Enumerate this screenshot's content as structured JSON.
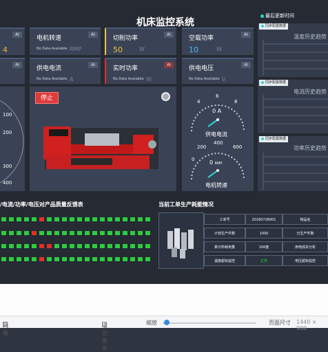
{
  "header": {
    "title": "机床监控系统",
    "update_text": "最后更新时间"
  },
  "cards": [
    {
      "label": "",
      "value": "4",
      "unit": "",
      "value_color": "#f0b030",
      "ai": "AI"
    },
    {
      "label": "电机转速",
      "value": "No Data Available",
      "unit": "RMP",
      "ai": "AI"
    },
    {
      "label": "切削功率",
      "value": "50",
      "unit": "W",
      "value_color": "#f0c040",
      "ai": "AI"
    },
    {
      "label": "空载功率",
      "value": "10",
      "unit": "W",
      "value_color": "#4db5ff",
      "ai": "AI"
    },
    {
      "label": "",
      "value": "",
      "unit": "",
      "ai": "AI"
    },
    {
      "label": "供电电流",
      "value": "No Data Available",
      "unit": "A",
      "ai": "AI"
    },
    {
      "label": "实时功率",
      "value": "No Data Available",
      "unit": "W",
      "ai": "AI"
    },
    {
      "label": "供电电压",
      "value": "No Data Available",
      "unit": "V",
      "ai": "AI"
    }
  ],
  "machine": {
    "stop_label": "停止"
  },
  "gauges": {
    "left_ticks": [
      "100",
      "200",
      "300",
      "400"
    ],
    "current": {
      "ticks": [
        "4",
        "6",
        "8"
      ],
      "value": "0",
      "unit": "A",
      "label": "供电电流"
    },
    "speed": {
      "ticks": [
        "0",
        "200",
        "400",
        "600"
      ],
      "value": "0",
      "unit": "RMP",
      "label": "电机转速"
    }
  },
  "charts": {
    "tag_label": "同步配置数据",
    "titles": [
      "温度历史趋势",
      "电流历史趋势",
      "功率历史趋势"
    ]
  },
  "quality": {
    "title": "/电流/功率/电压对产品质量反馈表",
    "rows": [
      [
        "g",
        "g",
        "g",
        "g",
        "g",
        "r",
        "g",
        "g",
        "g",
        "g",
        "g",
        "g",
        "g",
        "g",
        "g",
        "g",
        "g",
        "g",
        "g",
        "g"
      ],
      [
        "g",
        "g",
        "g",
        "g",
        "r",
        "g",
        "g",
        "g",
        "g",
        "g",
        "g",
        "g",
        "g",
        "g",
        "g",
        "g",
        "g",
        "g",
        "g",
        "g"
      ],
      [
        "g",
        "g",
        "g",
        "g",
        "g",
        "r",
        "r",
        "g",
        "g",
        "g",
        "g",
        "g",
        "g",
        "g",
        "g",
        "g",
        "g",
        "g",
        "g",
        "g"
      ],
      [
        "g",
        "g",
        "g",
        "g",
        "g",
        "r",
        "g",
        "g",
        "g",
        "g",
        "g",
        "g",
        "g",
        "g",
        "g",
        "g",
        "g",
        "g",
        "g",
        "g"
      ]
    ]
  },
  "energy": {
    "title": "当前工单生产耗能情况",
    "rows": [
      [
        "工单号",
        "20180728001",
        "物品名"
      ],
      [
        "计划生产件数",
        "1000",
        "已生产件数"
      ],
      [
        "累计所耗电量",
        "100度",
        "用电成本分析"
      ],
      [
        "温度超标监控",
        "正常",
        "电压超标监控"
      ]
    ]
  },
  "statusbar": {
    "grid_label": "网格",
    "fit_label": "适合画布",
    "zoom_label": "缩放",
    "page_size_label": "页面尺寸",
    "page_size_value": "1440 × 900"
  },
  "colors": {
    "green": "#2ecc40",
    "red": "#e0302a",
    "accent": "#2dd4d4"
  }
}
